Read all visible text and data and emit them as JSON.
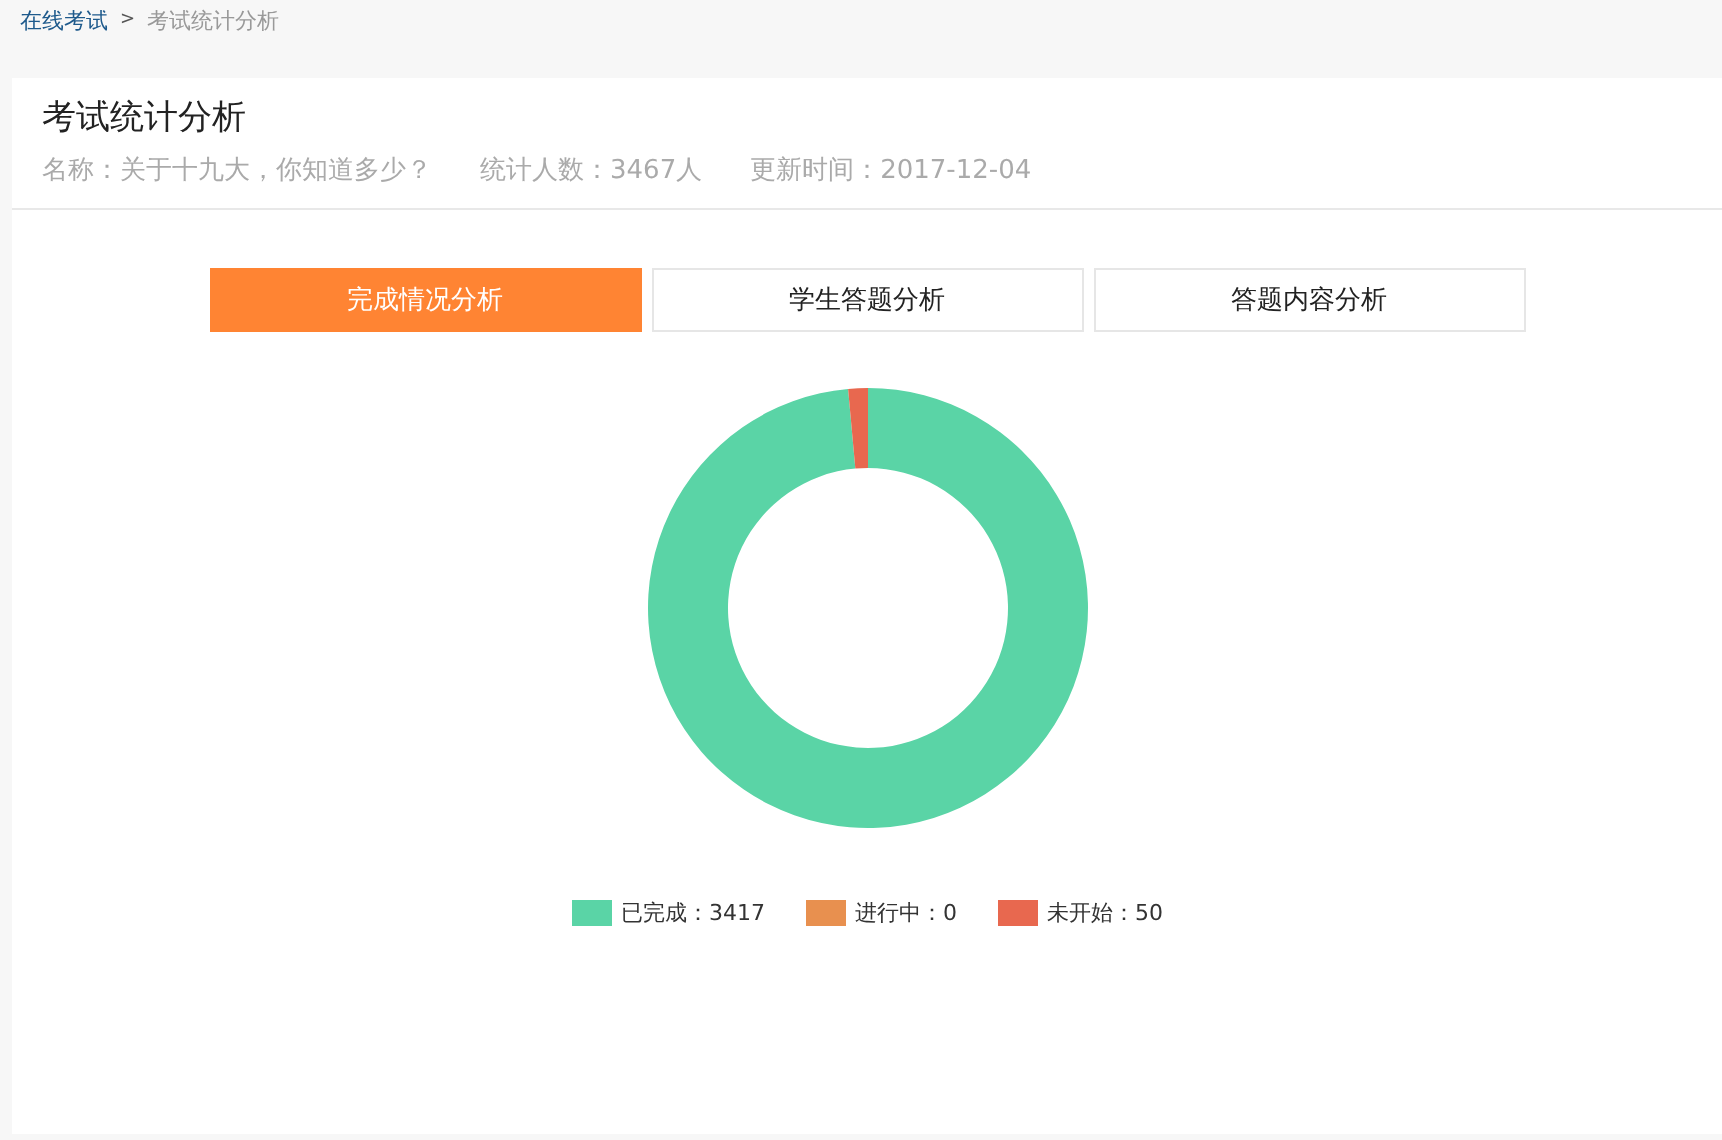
{
  "breadcrumb": [
    {
      "label": "在线考试",
      "kind": "link"
    },
    {
      "label": ">",
      "kind": "separator"
    },
    {
      "label": "考试统计分析",
      "kind": "current"
    }
  ],
  "page_title": "考试统计分析",
  "meta": [
    "名称：关于十九大，你知道多少？",
    "统计人数：3467人",
    "更新时间：2017-12-04"
  ],
  "tabs": [
    {
      "label": "完成情况分析",
      "selected": true
    },
    {
      "label": "学生答题分析",
      "selected": false
    },
    {
      "label": "答题内容分析",
      "selected": false
    }
  ],
  "chart_data": {
    "type": "donut",
    "categories": [
      "已完成：3417",
      "进行中：0",
      "未开始：50"
    ],
    "values": [
      3417,
      0,
      50
    ]
  },
  "legend": [
    {
      "color": "#5ad4a6"
    },
    {
      "color": "#e8904f"
    },
    {
      "color": "#e8684f"
    }
  ]
}
